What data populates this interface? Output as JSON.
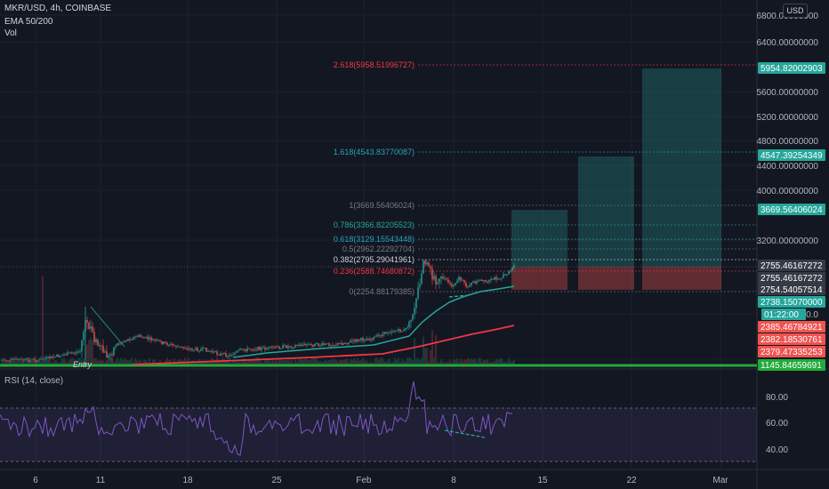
{
  "header": {
    "symbol_line": "MKR/USD, 4h, COINBASE",
    "indicator1": "EMA 50/200",
    "indicator2": "Vol",
    "currency": "USD"
  },
  "price_axis": [
    "6800.00000000",
    "6400.00000000",
    "5600.00000000",
    "5200.00000000",
    "4800.00000000",
    "4400.00000000",
    "4000.00000000",
    "3200.00000000",
    "2000.0"
  ],
  "price_labels": [
    {
      "text": "5954.82002903",
      "color": "#26a69a"
    },
    {
      "text": "4547.39254349",
      "color": "#26a69a"
    },
    {
      "text": "3669.56406024",
      "color": "#26a69a"
    },
    {
      "text": "2755.46167272",
      "color": "#363a45"
    },
    {
      "text": "2755.46167272",
      "color": "#363a45"
    },
    {
      "text": "2754.54057514",
      "color": "#363a45"
    },
    {
      "text": "2738.15070000",
      "color": "#26a69a"
    },
    {
      "text": "01:22:00",
      "color": "#26a69a"
    },
    {
      "text": "2385.46784921",
      "color": "#ef5350"
    },
    {
      "text": "2382.18530761",
      "color": "#ef5350"
    },
    {
      "text": "2379.47335253",
      "color": "#ef5350"
    },
    {
      "text": "1145.84659691",
      "color": "#22ab3a"
    }
  ],
  "fib_levels": [
    {
      "label": "2.618(5958.51996727)",
      "color": "#f23645"
    },
    {
      "label": "1.618(4543.83770087)",
      "color": "#22a6b3"
    },
    {
      "label": "1(3669.56406024)",
      "color": "#787b86"
    },
    {
      "label": "0.786(3366.82205523)",
      "color": "#26a69a"
    },
    {
      "label": "0.618(3129.15543448)",
      "color": "#22a6b3"
    },
    {
      "label": "0.5(2962.22292704)",
      "color": "#787b86"
    },
    {
      "label": "0.382(2795.29041961)",
      "color": "#d1d4dc"
    },
    {
      "label": "0.236(2588.74680872)",
      "color": "#f23645"
    },
    {
      "label": "0(2254.88179385)",
      "color": "#787b86"
    }
  ],
  "rsi": {
    "title": "RSI (14, close)",
    "axis": [
      "80.00",
      "60.00",
      "40.00"
    ]
  },
  "time_axis": [
    "6",
    "11",
    "18",
    "25",
    "Feb",
    "8",
    "15",
    "22",
    "Mar"
  ],
  "entry_label": "Entry",
  "colors": {
    "bg": "#131722",
    "up": "#26a69a",
    "down": "#ef5350",
    "ema50": "#26a69a",
    "ema200": "#f23645",
    "rsi_line": "#7e57c2",
    "support": "#22ab3a"
  }
}
